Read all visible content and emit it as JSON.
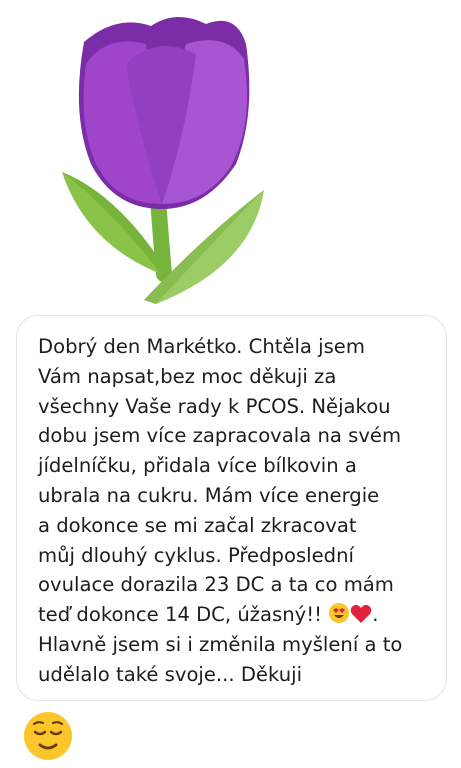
{
  "tulip_sticker": {
    "icon": "tulip-icon",
    "colors": {
      "petal": "#9e45c9",
      "petal_dark": "#7a2da6",
      "leaf": "#8bc34a",
      "leaf_dark": "#6aa532",
      "stem": "#76b43c"
    }
  },
  "message": {
    "text": "Dobrý den Markétko. Chtěla jsem\nVám napsat,bez moc děkuji za\nvšechny Vaše rady k PCOS. Nějakou\ndobu jsem více zapracovala na svém\njídelníčku, přidala více bílkovin a\nubrala na cukru. Mám více energie\na dokonce se mi začal zkracovat\nmůj dlouhý cyklus. Předposlední\novulace dorazila 23 DC a ta co mám\nteď dokonce 14 DC, úžasný!! ",
    "tail": ".\nHlavně jsem si i změnila myšlení a to\nudělalo také svoje... Děkuji",
    "emoji": [
      "smiling-face-with-heart-eyes-icon",
      "red-heart-icon"
    ]
  },
  "reaction": {
    "icon": "relieved-face-icon"
  }
}
